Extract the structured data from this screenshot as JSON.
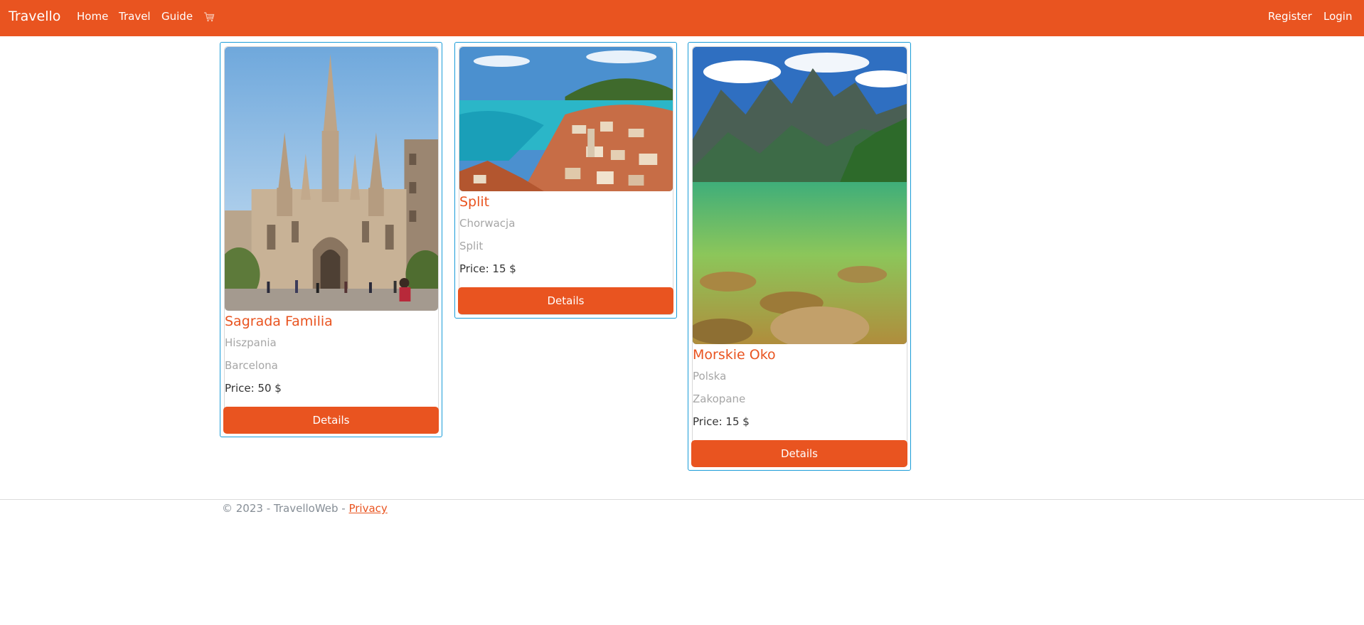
{
  "navbar": {
    "brand": "Travello",
    "links": [
      "Home",
      "Travel",
      "Guide"
    ],
    "cart_icon": "cart-icon",
    "right_links": [
      "Register",
      "Login"
    ],
    "color": "#e95420"
  },
  "cards": [
    {
      "title": "Sagrada Familia",
      "country": "Hiszpania",
      "city": "Barcelona",
      "price": "Price: 50 $",
      "button": "Details",
      "image": "cathedral-photo"
    },
    {
      "title": "Split",
      "country": "Chorwacja",
      "city": "Split",
      "price": "Price: 15 $",
      "button": "Details",
      "image": "coastal-city-photo"
    },
    {
      "title": "Morskie Oko",
      "country": "Polska",
      "city": "Zakopane",
      "price": "Price: 15 $",
      "button": "Details",
      "image": "mountain-lake-photo"
    }
  ],
  "footer": {
    "text": "© 2023 - TravelloWeb - ",
    "link": "Privacy"
  },
  "colors": {
    "accent": "#e95420",
    "card_border": "#1a9cd8",
    "muted": "#a6a6a6"
  }
}
